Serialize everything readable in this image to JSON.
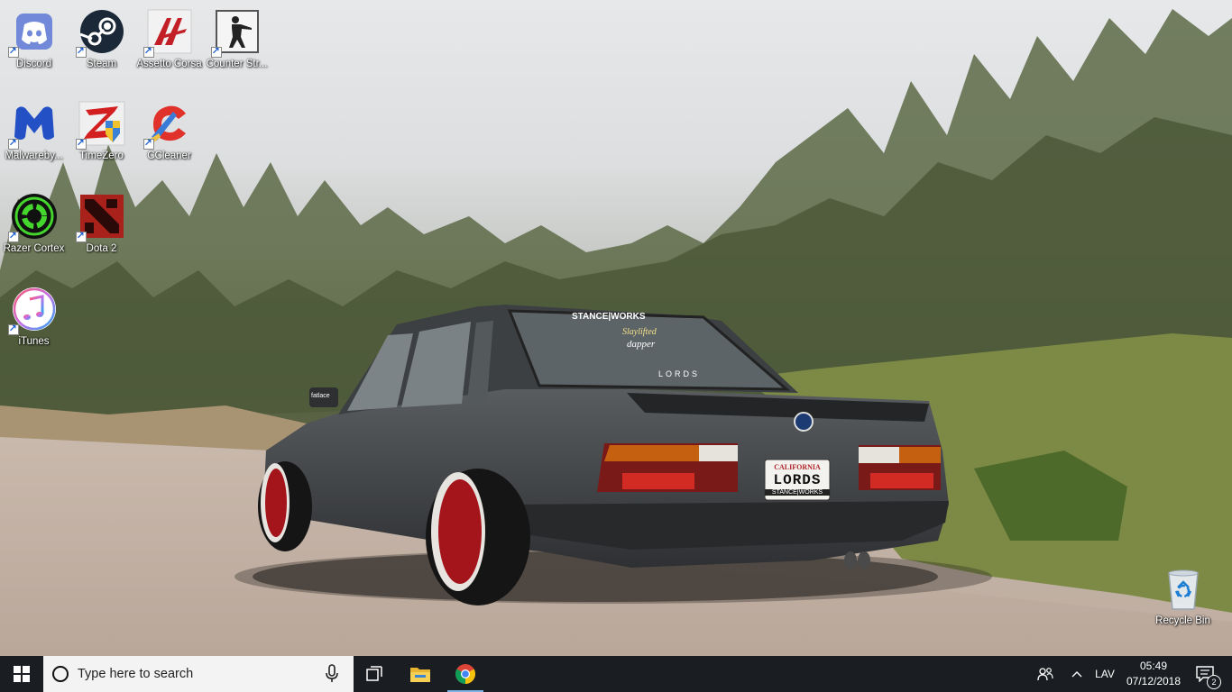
{
  "desktop": {
    "icons": [
      {
        "label": "Discord",
        "icon": "discord-icon"
      },
      {
        "label": "Steam",
        "icon": "steam-icon"
      },
      {
        "label": "Assetto Corsa",
        "icon": "assetto-corsa-icon"
      },
      {
        "label": "Counter Str...",
        "icon": "counter-strike-icon"
      },
      {
        "label": "Malwareby...",
        "icon": "malwarebytes-icon"
      },
      {
        "label": "TimeZero",
        "icon": "timezero-icon"
      },
      {
        "label": "CCleaner",
        "icon": "ccleaner-icon"
      },
      {
        "label": "Razer Cortex",
        "icon": "razer-cortex-icon"
      },
      {
        "label": "Dota 2",
        "icon": "dota2-icon"
      },
      {
        "label": "iTunes",
        "icon": "itunes-icon"
      },
      {
        "label": "Recycle Bin",
        "icon": "recycle-bin-icon"
      }
    ],
    "wallpaper": {
      "plate_top": "CALIFORNIA",
      "plate_main": "LORDS",
      "plate_bottom": "STANCE|WORKS",
      "window_stickers": [
        "STANCE|WORKS",
        "Slaylifted",
        "dapper",
        "LORDS"
      ],
      "side_sticker": "fatlace"
    }
  },
  "taskbar": {
    "search_placeholder": "Type here to search",
    "pinned": [
      {
        "name": "task-view",
        "icon": "task-view-icon"
      },
      {
        "name": "file-explorer",
        "icon": "folder-icon"
      },
      {
        "name": "chrome",
        "icon": "chrome-icon",
        "active": true
      }
    ],
    "tray": {
      "language": "LAV",
      "time": "05:49",
      "date": "07/12/2018",
      "notification_count": "2"
    }
  },
  "colors": {
    "taskbar_bg": "#1a1d21",
    "search_bg": "#f3f3f3",
    "active_indicator": "#7fb4e6"
  }
}
